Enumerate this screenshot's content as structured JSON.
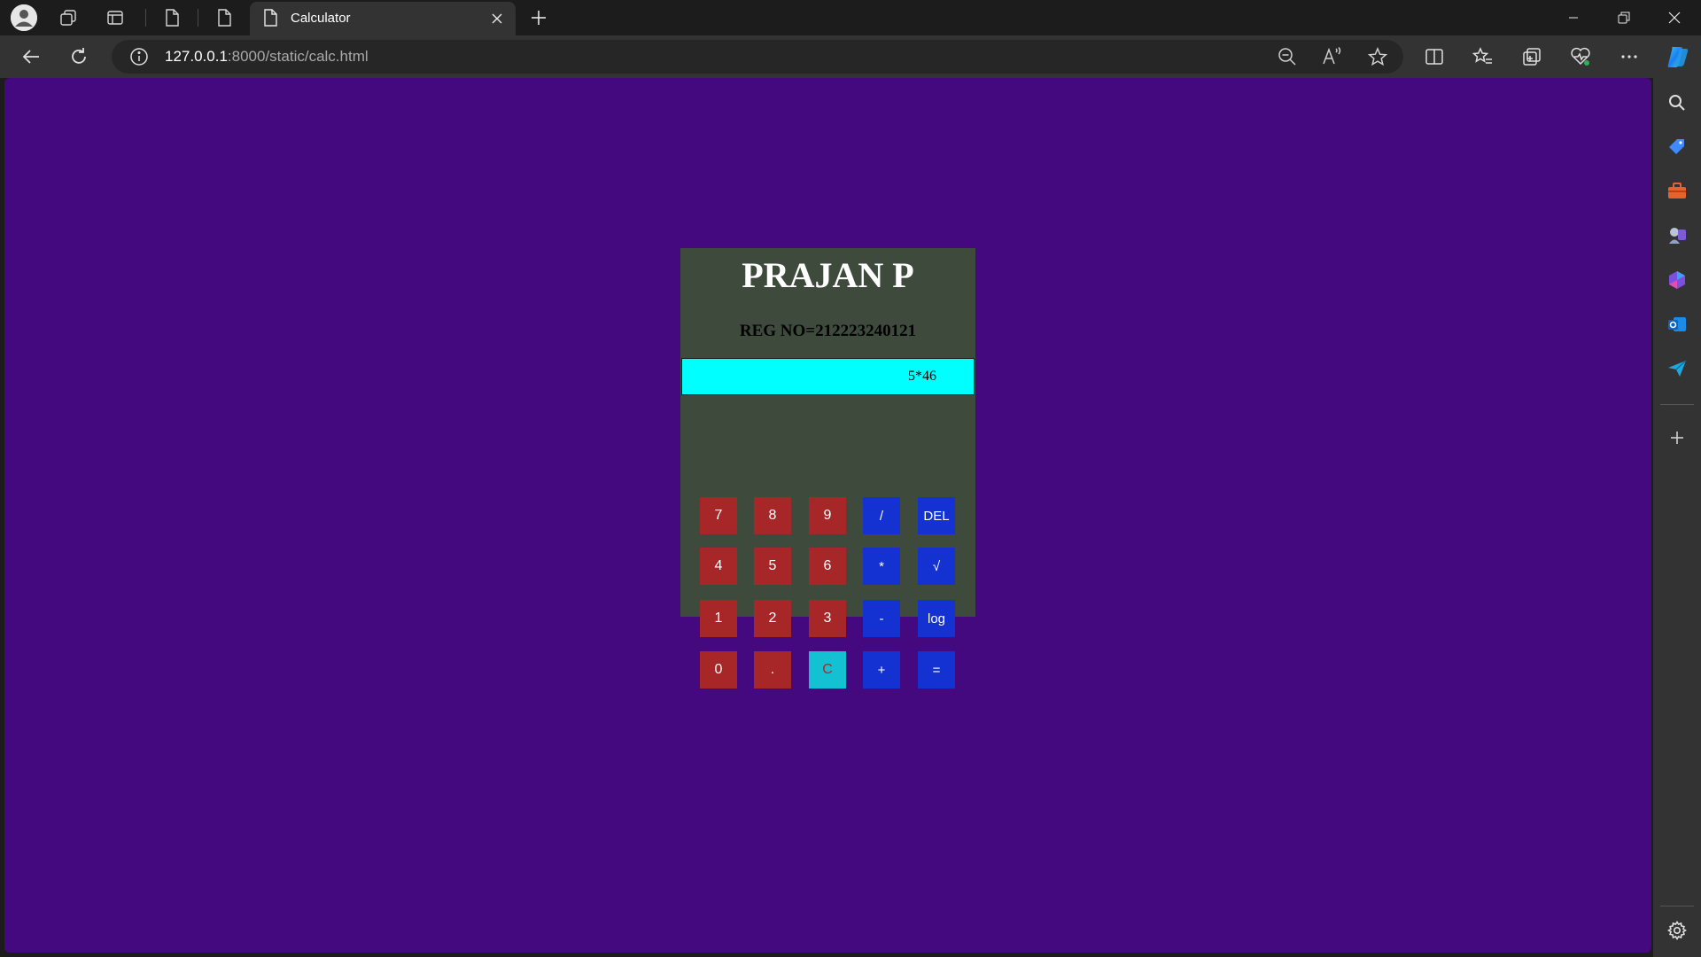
{
  "browser": {
    "tab_title": "Calculator",
    "url_host": "127.0.0.1",
    "url_rest": ":8000/static/calc.html"
  },
  "page": {
    "background": "#44087f"
  },
  "calculator": {
    "name": "PRAJAN P",
    "reg": "REG NO=212223240121",
    "display": "5*46",
    "keys": {
      "k7": "7",
      "k8": "8",
      "k9": "9",
      "div": "/",
      "del": "DEL",
      "k4": "4",
      "k5": "5",
      "k6": "6",
      "mul": "*",
      "sqrt": "√",
      "k1": "1",
      "k2": "2",
      "k3": "3",
      "sub": "-",
      "log": "log",
      "k0": "0",
      "dot": ".",
      "clear": "C",
      "add": "+",
      "eq": "="
    },
    "colors": {
      "panel": "#3d4a3c",
      "display": "#00ffff",
      "number_key": "#a72729",
      "operator_key": "#1432d2",
      "clear_key": "#14c1d2"
    }
  }
}
